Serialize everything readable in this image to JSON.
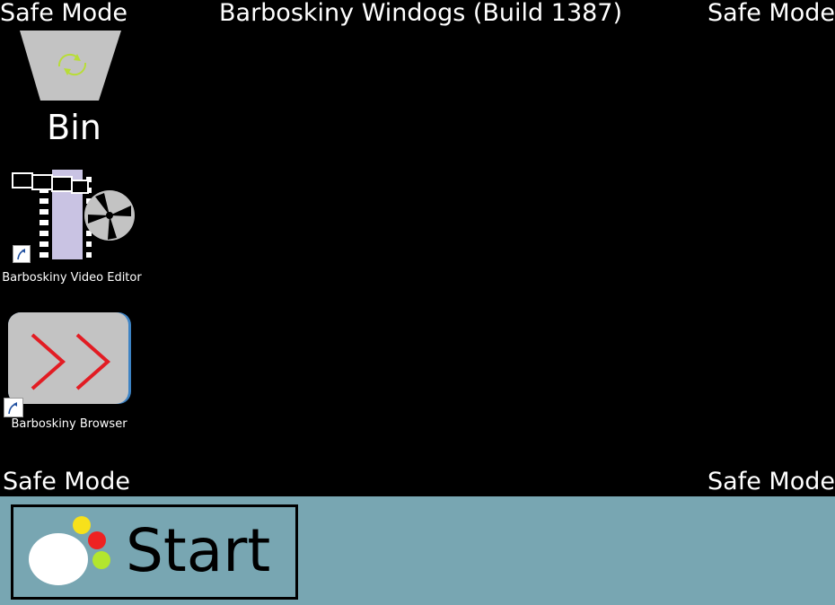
{
  "watermarks": {
    "top_left": "Safe Mode",
    "top_right": "Safe Mode",
    "bottom_left": "Safe Mode",
    "bottom_right": "Safe Mode"
  },
  "title": "Barboskiny Windogs (Build 1387)",
  "desktop_icons": [
    {
      "label": "Bin",
      "icon": "recycle-bin-icon"
    },
    {
      "label": "Barboskiny Video Editor",
      "icon": "video-editor-icon",
      "shortcut": true
    },
    {
      "label": "Barboskiny Browser",
      "icon": "browser-icon",
      "shortcut": true
    }
  ],
  "taskbar": {
    "start_label": "Start",
    "start_logo_colors": [
      "#ffffff",
      "#f7e11b",
      "#ee2222",
      "#b3e62e"
    ]
  },
  "colors": {
    "desktop_background": "#000000",
    "taskbar_background": "#78a6b2"
  }
}
